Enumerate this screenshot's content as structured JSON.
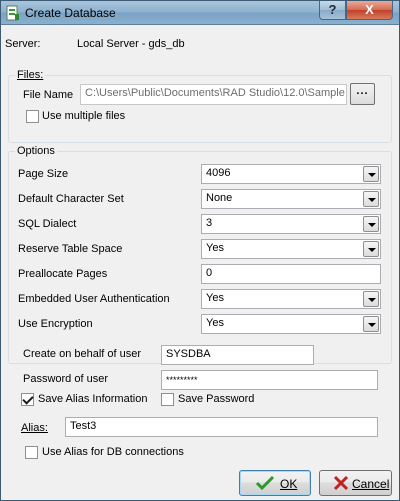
{
  "window": {
    "title": "Create Database",
    "help_glyph": "?",
    "close_glyph": "X"
  },
  "server": {
    "label": "Server:",
    "value": "Local Server - gds_db"
  },
  "files": {
    "title": "Files:",
    "file_name_label": "File Name",
    "file_name_value": "C:\\Users\\Public\\Documents\\RAD Studio\\12.0\\Sample",
    "browse_label": "...",
    "use_multiple_files_label": "Use multiple files",
    "use_multiple_files_checked": false
  },
  "options": {
    "title": "Options",
    "rows": [
      {
        "label": "Page Size",
        "value": "4096",
        "kind": "combo"
      },
      {
        "label": "Default Character Set",
        "value": "None",
        "kind": "combo"
      },
      {
        "label": "SQL Dialect",
        "value": "3",
        "kind": "combo"
      },
      {
        "label": "Reserve Table Space",
        "value": "Yes",
        "kind": "combo"
      },
      {
        "label": "Preallocate Pages",
        "value": "0",
        "kind": "edit"
      },
      {
        "label": "Embedded User Authentication",
        "value": "Yes",
        "kind": "combo"
      },
      {
        "label": "Use Encryption",
        "value": "Yes",
        "kind": "combo"
      }
    ]
  },
  "user": {
    "behalf_label": "Create on behalf of user",
    "behalf_value": "SYSDBA",
    "password_label": "Password of user",
    "password_value": "*********"
  },
  "alias": {
    "save_alias_label": "Save Alias Information",
    "save_alias_checked": true,
    "save_password_label": "Save Password",
    "save_password_checked": false,
    "alias_label": "Alias:",
    "alias_value": "Test3",
    "use_alias_label": "Use Alias for DB connections",
    "use_alias_checked": false
  },
  "buttons": {
    "ok_label": "OK",
    "cancel_label": "Cancel"
  },
  "colors": {
    "ok_icon": "#2a9a2a",
    "cancel_icon": "#c02020"
  }
}
